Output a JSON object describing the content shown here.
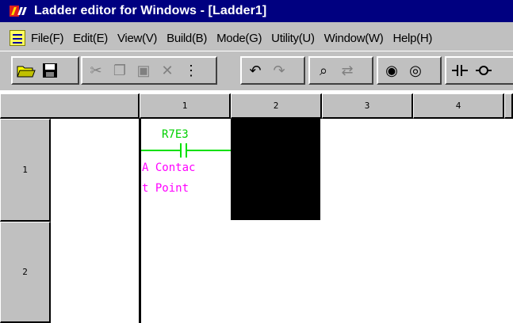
{
  "titlebar": {
    "title": "Ladder editor for Windows - [Ladder1]"
  },
  "menu": {
    "items": [
      "File(F)",
      "Edit(E)",
      "View(V)",
      "Build(B)",
      "Mode(G)",
      "Utility(U)",
      "Window(W)",
      "Help(H)"
    ]
  },
  "toolbar": {
    "buttons": [
      "open-folder-icon",
      "save-icon",
      "cut-icon",
      "copy-icon",
      "paste-icon",
      "delete-icon",
      "insert-line-icon",
      "undo-icon",
      "redo-icon",
      "find-icon",
      "find-replace-icon",
      "download-icon",
      "upload-icon",
      "contact-icon",
      "coil-icon"
    ]
  },
  "grid": {
    "columns": [
      "1",
      "2",
      "3",
      "4"
    ],
    "rows": [
      "1",
      "2"
    ]
  },
  "ladder": {
    "contact_address": "R7E3",
    "comment_line1": "A Contac",
    "comment_line2": "t Point"
  }
}
